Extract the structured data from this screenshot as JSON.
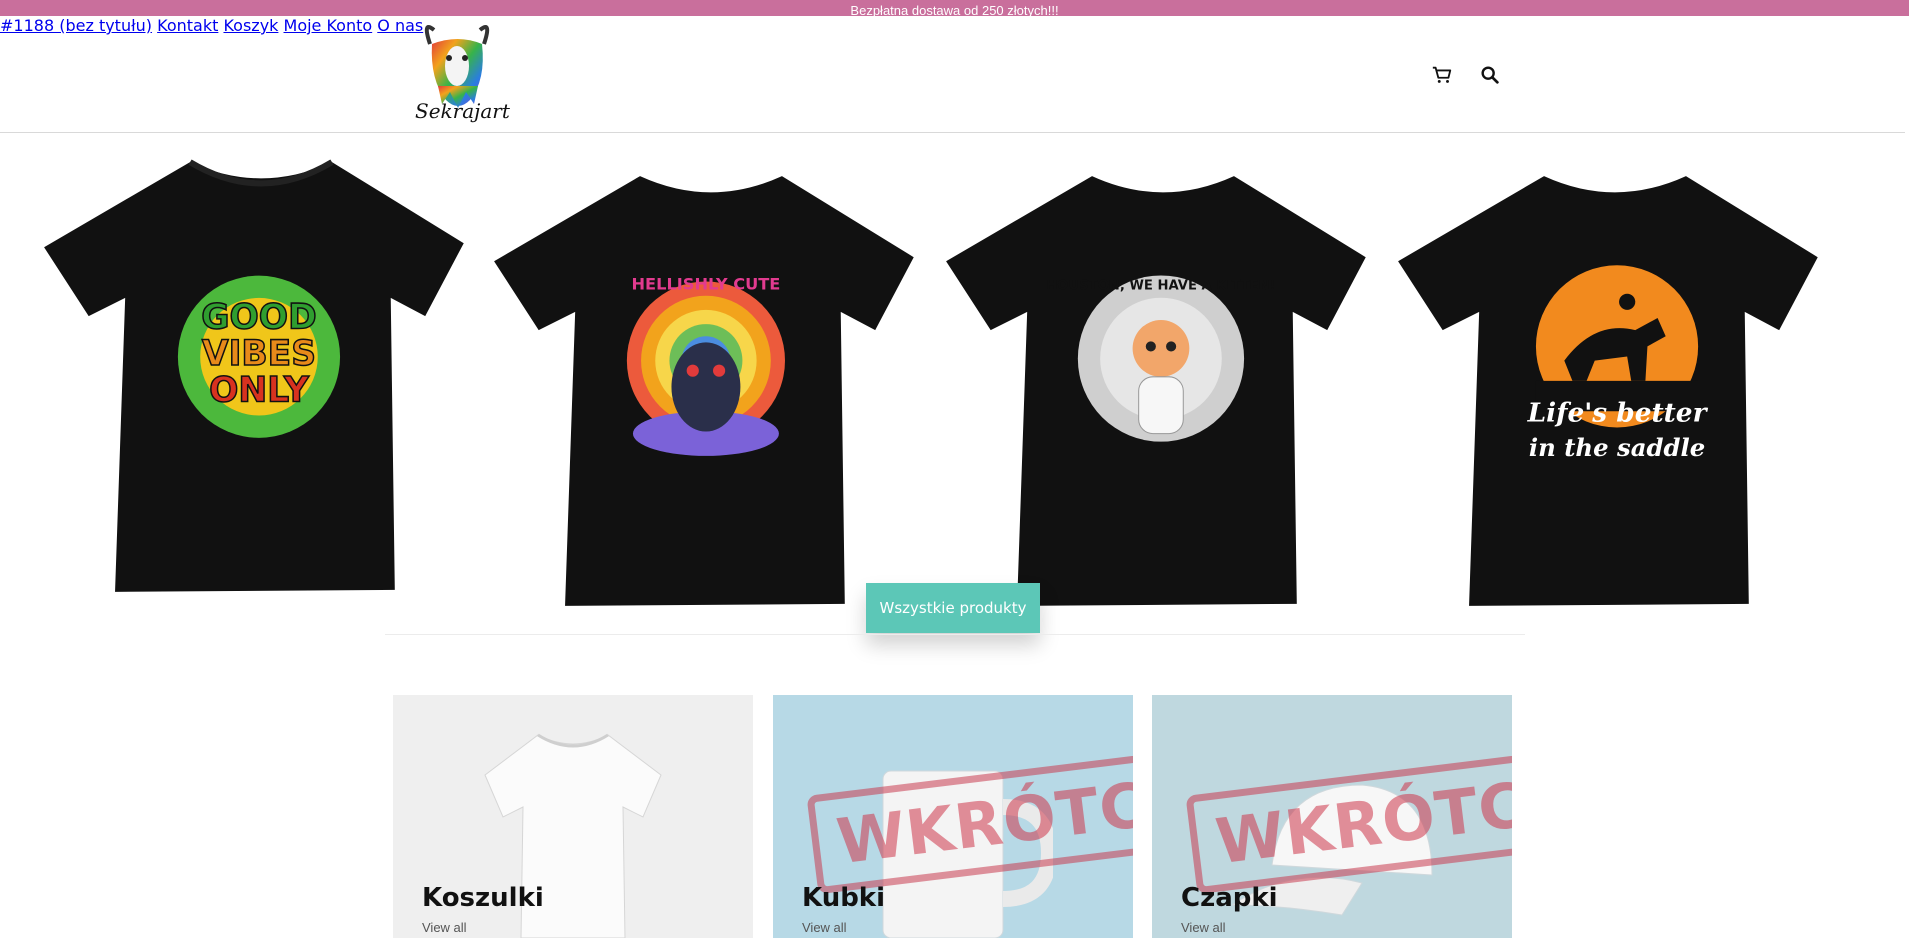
{
  "topbar": {
    "text": "Bezpłatna dostawa od 250 złotych!!!"
  },
  "header": {
    "logo_text": "Sekrajart",
    "nav": {
      "item1": "#1188 (bez tytułu)",
      "item2": "Kontakt",
      "item3": "Koszyk",
      "item4": "Moje Konto",
      "item5": "O nas"
    },
    "icons": {
      "cart": "cart-icon",
      "search": "search-icon"
    }
  },
  "hero": {
    "shirts": [
      {
        "design": "Good Vibes Only",
        "line1": "GOOD",
        "line2": "VIBES",
        "line3": "ONLY"
      },
      {
        "design": "Hellishly Cute",
        "arc": "HELLISHLY CUTE"
      },
      {
        "design": "Houston, we have a kitten!",
        "arc": "HOUSTON, WE HAVE A KITTEN!"
      },
      {
        "design": "Life's better in the saddle",
        "line1": "Life's better",
        "line2": "in the saddle"
      }
    ],
    "button_label": "Wszystkie produkty"
  },
  "categories": [
    {
      "title": "Koszulki",
      "link": "View all",
      "bg": "#efefef"
    },
    {
      "title": "Kubki",
      "link": "View all",
      "bg": "#b7d9e6",
      "stamp": "WKRÓTCE"
    },
    {
      "title": "Czapki",
      "link": "View all",
      "bg": "#bfd8df",
      "stamp": "WKRÓTCE"
    }
  ],
  "colors": {
    "topbar": "#c96f9c",
    "button": "#5cc7b7"
  }
}
